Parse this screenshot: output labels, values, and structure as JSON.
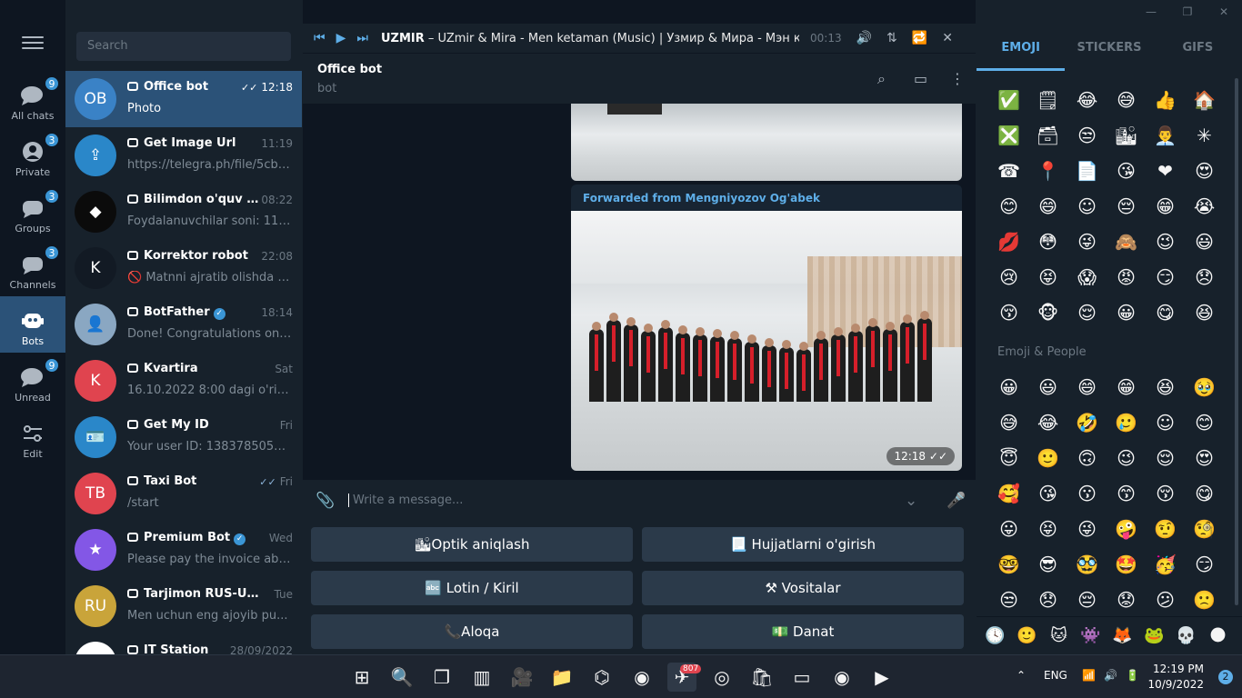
{
  "rail": {
    "folders": [
      {
        "label": "All chats",
        "badge": "9"
      },
      {
        "label": "Private",
        "badge": "3"
      },
      {
        "label": "Groups",
        "badge": "3"
      },
      {
        "label": "Channels",
        "badge": "3"
      },
      {
        "label": "Bots",
        "badge": ""
      },
      {
        "label": "Unread",
        "badge": "9"
      },
      {
        "label": "Edit",
        "badge": ""
      }
    ]
  },
  "search": {
    "placeholder": "Search"
  },
  "chats": [
    {
      "name": "Office bot",
      "time": "12:18",
      "msg": "Photo",
      "avatar": "OB",
      "color": "#3a82c6"
    },
    {
      "name": "Get Image Url",
      "time": "11:19",
      "msg": "https://telegra.ph/file/5cbac...",
      "avatar": "⇪",
      "color": "#2a87c9"
    },
    {
      "name": "Bilimdon o'quv m...",
      "time": "08:22",
      "msg": "Foydalanuvchilar soni: 11 Bu...",
      "avatar": "◆",
      "color": "#0b0b0b"
    },
    {
      "name": "Korrektor robot",
      "time": "22:08",
      "msg": "🚫 Matnni ajratib olishda m...",
      "avatar": "K",
      "color": "#121a24"
    },
    {
      "name": "BotFather",
      "time": "18:14",
      "msg": "Done! Congratulations on yo...",
      "avatar": "👤",
      "color": "#8aa7c2"
    },
    {
      "name": "Kvartira",
      "time": "Sat",
      "msg": "16.10.2022 8:00 dagi o'rinlar t...",
      "avatar": "K",
      "color": "#e0444f"
    },
    {
      "name": "Get My ID",
      "time": "Fri",
      "msg": "Your user ID: 1383785054 Cur...",
      "avatar": "🪪",
      "color": "#2a87c9"
    },
    {
      "name": "Taxi Bot",
      "time": "Fri",
      "msg": "/start",
      "avatar": "TB",
      "color": "#e0444f"
    },
    {
      "name": "Premium Bot",
      "time": "Wed",
      "msg": "Please pay the invoice above...",
      "avatar": "★",
      "color": "#8357e6"
    },
    {
      "name": "Tarjimon RUS-UZB",
      "time": "Tue",
      "msg": "Men uchun eng ajoyib pu...",
      "avatar": "RU",
      "color": "#c9a43a"
    },
    {
      "name": "IT Station",
      "time": "28/09/2022",
      "msg": "",
      "avatar": "",
      "color": "#ffffff"
    }
  ],
  "player": {
    "artist": "UZMIR",
    "title": " – UZmir & Mira - Men ketaman (Music) | Узмир & Мира - Мэн кэтаман",
    "time": "00:13"
  },
  "header": {
    "title": "Office bot",
    "subtitle": "bot"
  },
  "message": {
    "forwarded": "Forwarded from Mengniyozov Og'abek",
    "time": "12:18"
  },
  "composer": {
    "placeholder": "Write a message..."
  },
  "keyboard": [
    "🏙Optik aniqlash",
    "📃 Hujjatlarni o'girish",
    "🔤 Lotin / Kiril",
    "⚒ Vositalar",
    "📞Aloqa",
    "💵 Danat"
  ],
  "emoji_panel": {
    "tabs": [
      "EMOJI",
      "STICKERS",
      "GIFS"
    ],
    "recent": [
      "✅",
      "🗒",
      "😂",
      "😅",
      "👍",
      "🏠",
      "❎",
      "🗃",
      "😒",
      "🏙",
      "👨‍💼",
      "✳",
      "☎",
      "📍",
      "📄",
      "😘",
      "❤",
      "😍",
      "😊",
      "😄",
      "☺",
      "😔",
      "😁",
      "😭",
      "💋",
      "😳",
      "😜",
      "🙈",
      "😉",
      "😃",
      "😢",
      "😝",
      "😱",
      "😡",
      "😏",
      "😞",
      "😚",
      "🐵",
      "😌",
      "😀",
      "😋",
      "😆"
    ],
    "section_title": "Emoji & People",
    "people": [
      "😀",
      "😃",
      "😄",
      "😁",
      "😆",
      "🥹",
      "😅",
      "😂",
      "🤣",
      "🥲",
      "☺",
      "😊",
      "😇",
      "🙂",
      "🙃",
      "😉",
      "😌",
      "😍",
      "🥰",
      "😘",
      "😗",
      "😙",
      "😚",
      "😋",
      "😛",
      "😝",
      "😜",
      "🤪",
      "🤨",
      "🧐",
      "🤓",
      "😎",
      "🥸",
      "🤩",
      "🥳",
      "😏",
      "😒",
      "😞",
      "😔",
      "😟",
      "😕",
      "🙁"
    ],
    "bottom": [
      "🕓",
      "🙂",
      "🐱",
      "👾",
      "🦊",
      "🐸",
      "💀",
      "🌑"
    ]
  },
  "taskbar": {
    "apps": [
      "⊞",
      "🔍",
      "❐",
      "▥",
      "🎥",
      "📁",
      "⌬",
      "◉",
      "✈",
      "◎",
      "🛍",
      "▭",
      "◉",
      "▶"
    ],
    "telegram_badge": "807",
    "lang": "ENG",
    "time": "12:19 PM",
    "date": "10/9/2022",
    "notifications": "2"
  }
}
